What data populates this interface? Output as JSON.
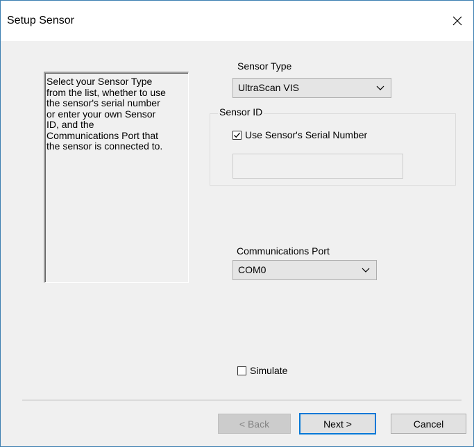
{
  "window": {
    "title": "Setup Sensor",
    "close_symbol": "✕"
  },
  "help_text": "Select your Sensor Type\nfrom the list, whether to use\nthe sensor's serial number\nor enter your own Sensor\nID, and the\nCommunications Port that\nthe sensor is connected to.",
  "sensor_type": {
    "label": "Sensor Type",
    "selected": "UltraScan VIS"
  },
  "sensor_id": {
    "group_label": "Sensor ID",
    "use_serial_label": "Use Sensor's Serial Number",
    "use_serial_checked": true,
    "id_value": ""
  },
  "comm_port": {
    "label": "Communications Port",
    "selected": "COM0"
  },
  "simulate": {
    "label": "Simulate",
    "checked": false
  },
  "buttons": {
    "back": "< Back",
    "next": "Next >",
    "cancel": "Cancel"
  },
  "colors": {
    "default_button_border": "#0078d7",
    "dialog_background": "#f0f0f0"
  },
  "icons": {
    "close": "close-icon",
    "dropdown": "chevron-down-icon",
    "check": "checkmark-icon"
  }
}
